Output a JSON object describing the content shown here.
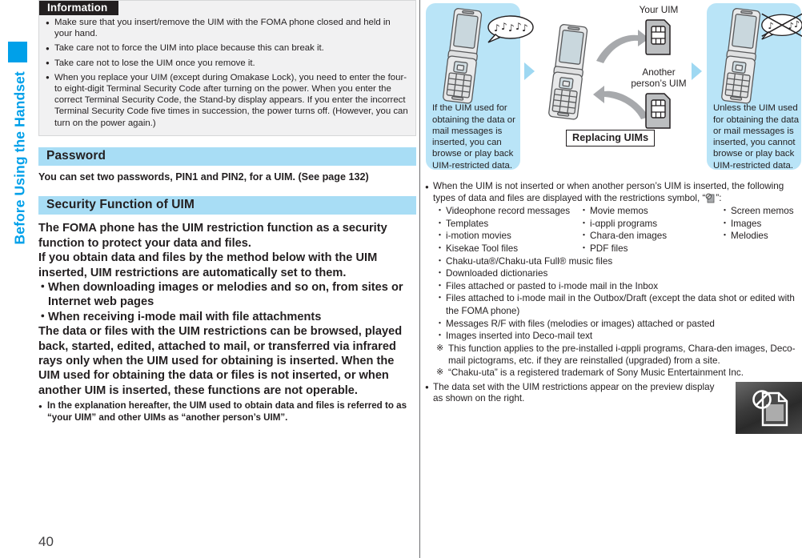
{
  "side_tab": {
    "label": "Before Using the Handset",
    "color": "#00a0e9"
  },
  "page_number": "40",
  "information": {
    "title": "Information",
    "items": [
      "Make sure that you insert/remove the UIM with the FOMA phone closed and held in your hand.",
      "Take care not to force the UIM into place because this can break it.",
      "Take care not to lose the UIM once you remove it.",
      "When you replace your UIM (except during Omakase Lock), you need to enter the four- to eight-digit Terminal Security Code after turning on the power. When you enter the correct Terminal Security Code, the Stand-by display appears. If you enter the incorrect Terminal Security Code five times in succession, the power turns off. (However, you can turn on the power again.)"
    ]
  },
  "password_section": {
    "heading": "Password",
    "body": "You can set two passwords, PIN1 and PIN2, for a UIM. (See page 132)"
  },
  "security_section": {
    "heading": "Security Function of UIM",
    "para1": "The FOMA phone has the UIM restriction function as a security function to protect your data and files.",
    "para2": "If you obtain data and files by the method below with the UIM inserted, UIM restrictions are automatically set to them.",
    "dash_items": [
      "When downloading images or melodies and so on, from sites or Internet web pages",
      "When receiving i-mode mail with file attachments"
    ],
    "para3": "The data or files with the UIM restrictions can be browsed, played back, started, edited, attached to mail, or transferred via infrared rays only when the UIM used for obtaining is inserted. When the UIM used for obtaining the data or files is not inserted, or when another UIM is inserted, these functions are not operable.",
    "note": "In the explanation hereafter, the UIM used to obtain data and files is referred to as “your UIM” and other UIMs as “another person’s UIM”."
  },
  "figure": {
    "panel_color": "#b9e4f7",
    "left_caption": "If the UIM used for obtaining the data or mail messages is inserted, you can browse or play back UIM-restricted data.",
    "right_caption": "Unless the UIM used for obtaining the data or mail messages is inserted, you cannot browse or play back UIM-restricted data.",
    "your_uim_label": "Your UIM",
    "other_uim_label": "Another\nperson’s UIM",
    "other_uim_label_line1": "Another",
    "other_uim_label_line2": "person’s UIM",
    "replacing_label": "Replacing UIMs"
  },
  "right_text": {
    "intro_part1": "When the UIM is not inserted or when another person’s UIM is inserted, the following types of data and files are displayed with the restrictions symbol, “",
    "intro_part2": "”:",
    "grid_items": [
      "Videophone record messages",
      "Movie memos",
      "Screen memos",
      "Templates",
      "i-αppli programs",
      "Images",
      "i-motion movies",
      "Chara-den images",
      "Melodies",
      "Kisekae Tool files",
      "PDF files",
      ""
    ],
    "list_items": [
      "Chaku-uta®/Chaku-uta Full® music files",
      "Downloaded dictionaries",
      "Files attached or pasted to i-mode mail in the Inbox",
      "Files attached to i-mode mail in the Outbox/Draft (except the data shot or edited with the FOMA phone)",
      "Messages R/F with files (melodies or images) attached or pasted",
      "Images inserted into Deco-mail text"
    ],
    "notes": [
      "This function applies to the pre-installed i-αppli programs, Chara-den images, Deco-mail pictograms, etc. if they are reinstalled (upgraded) from a site.",
      "“Chaku-uta” is a registered trademark of Sony Music Entertainment Inc."
    ],
    "final_bullet": "The data set with the UIM restrictions appear on the preview display as shown on the right."
  }
}
